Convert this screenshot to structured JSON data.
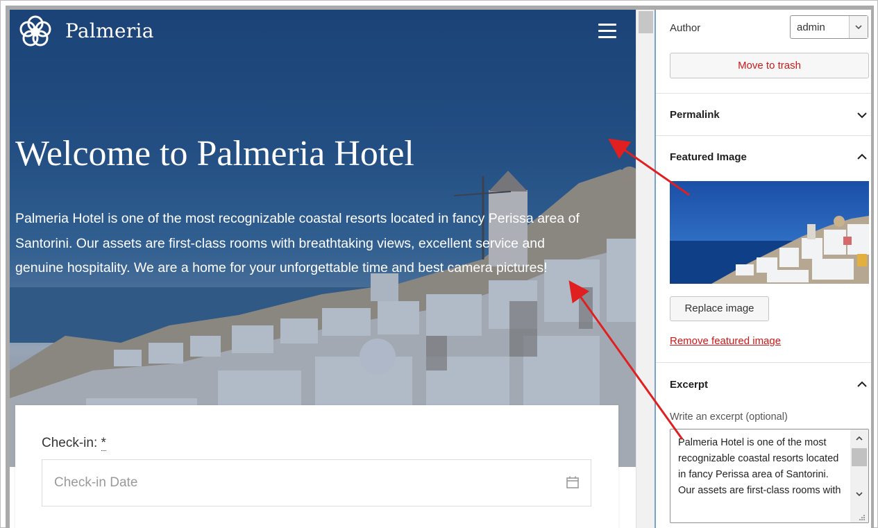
{
  "preview": {
    "site_name": "Palmeria",
    "hero_title": "Welcome to Palmeria Hotel",
    "hero_text": "Palmeria Hotel is one of the most recognizable coastal resorts located in fancy Perissa area of Santorini. Our assets are first-class rooms with breathtaking views, excellent service and genuine hospitality. We are a home for your unforgettable time and best camera pictures!",
    "booking": {
      "checkin_label": "Check-in:",
      "required_mark": "*",
      "checkin_placeholder": "Check-in Date"
    }
  },
  "sidebar": {
    "author_label": "Author",
    "author_value": "admin",
    "trash_label": "Move to trash",
    "permalink_title": "Permalink",
    "featured_title": "Featured Image",
    "replace_label": "Replace image",
    "remove_label": "Remove featured image",
    "excerpt_title": "Excerpt",
    "excerpt_label": "Write an excerpt (optional)",
    "excerpt_text": "Palmeria Hotel is one of the most recognizable coastal resorts located in fancy Perissa area of Santorini. Our assets are first-class rooms with"
  },
  "colors": {
    "danger": "#cc1818",
    "hero_blue": "#1e4b83",
    "arrow": "#e02020"
  },
  "icons": [
    "flower-logo-icon",
    "hamburger-menu-icon",
    "calendar-icon",
    "chevron-down-icon",
    "chevron-up-icon"
  ]
}
